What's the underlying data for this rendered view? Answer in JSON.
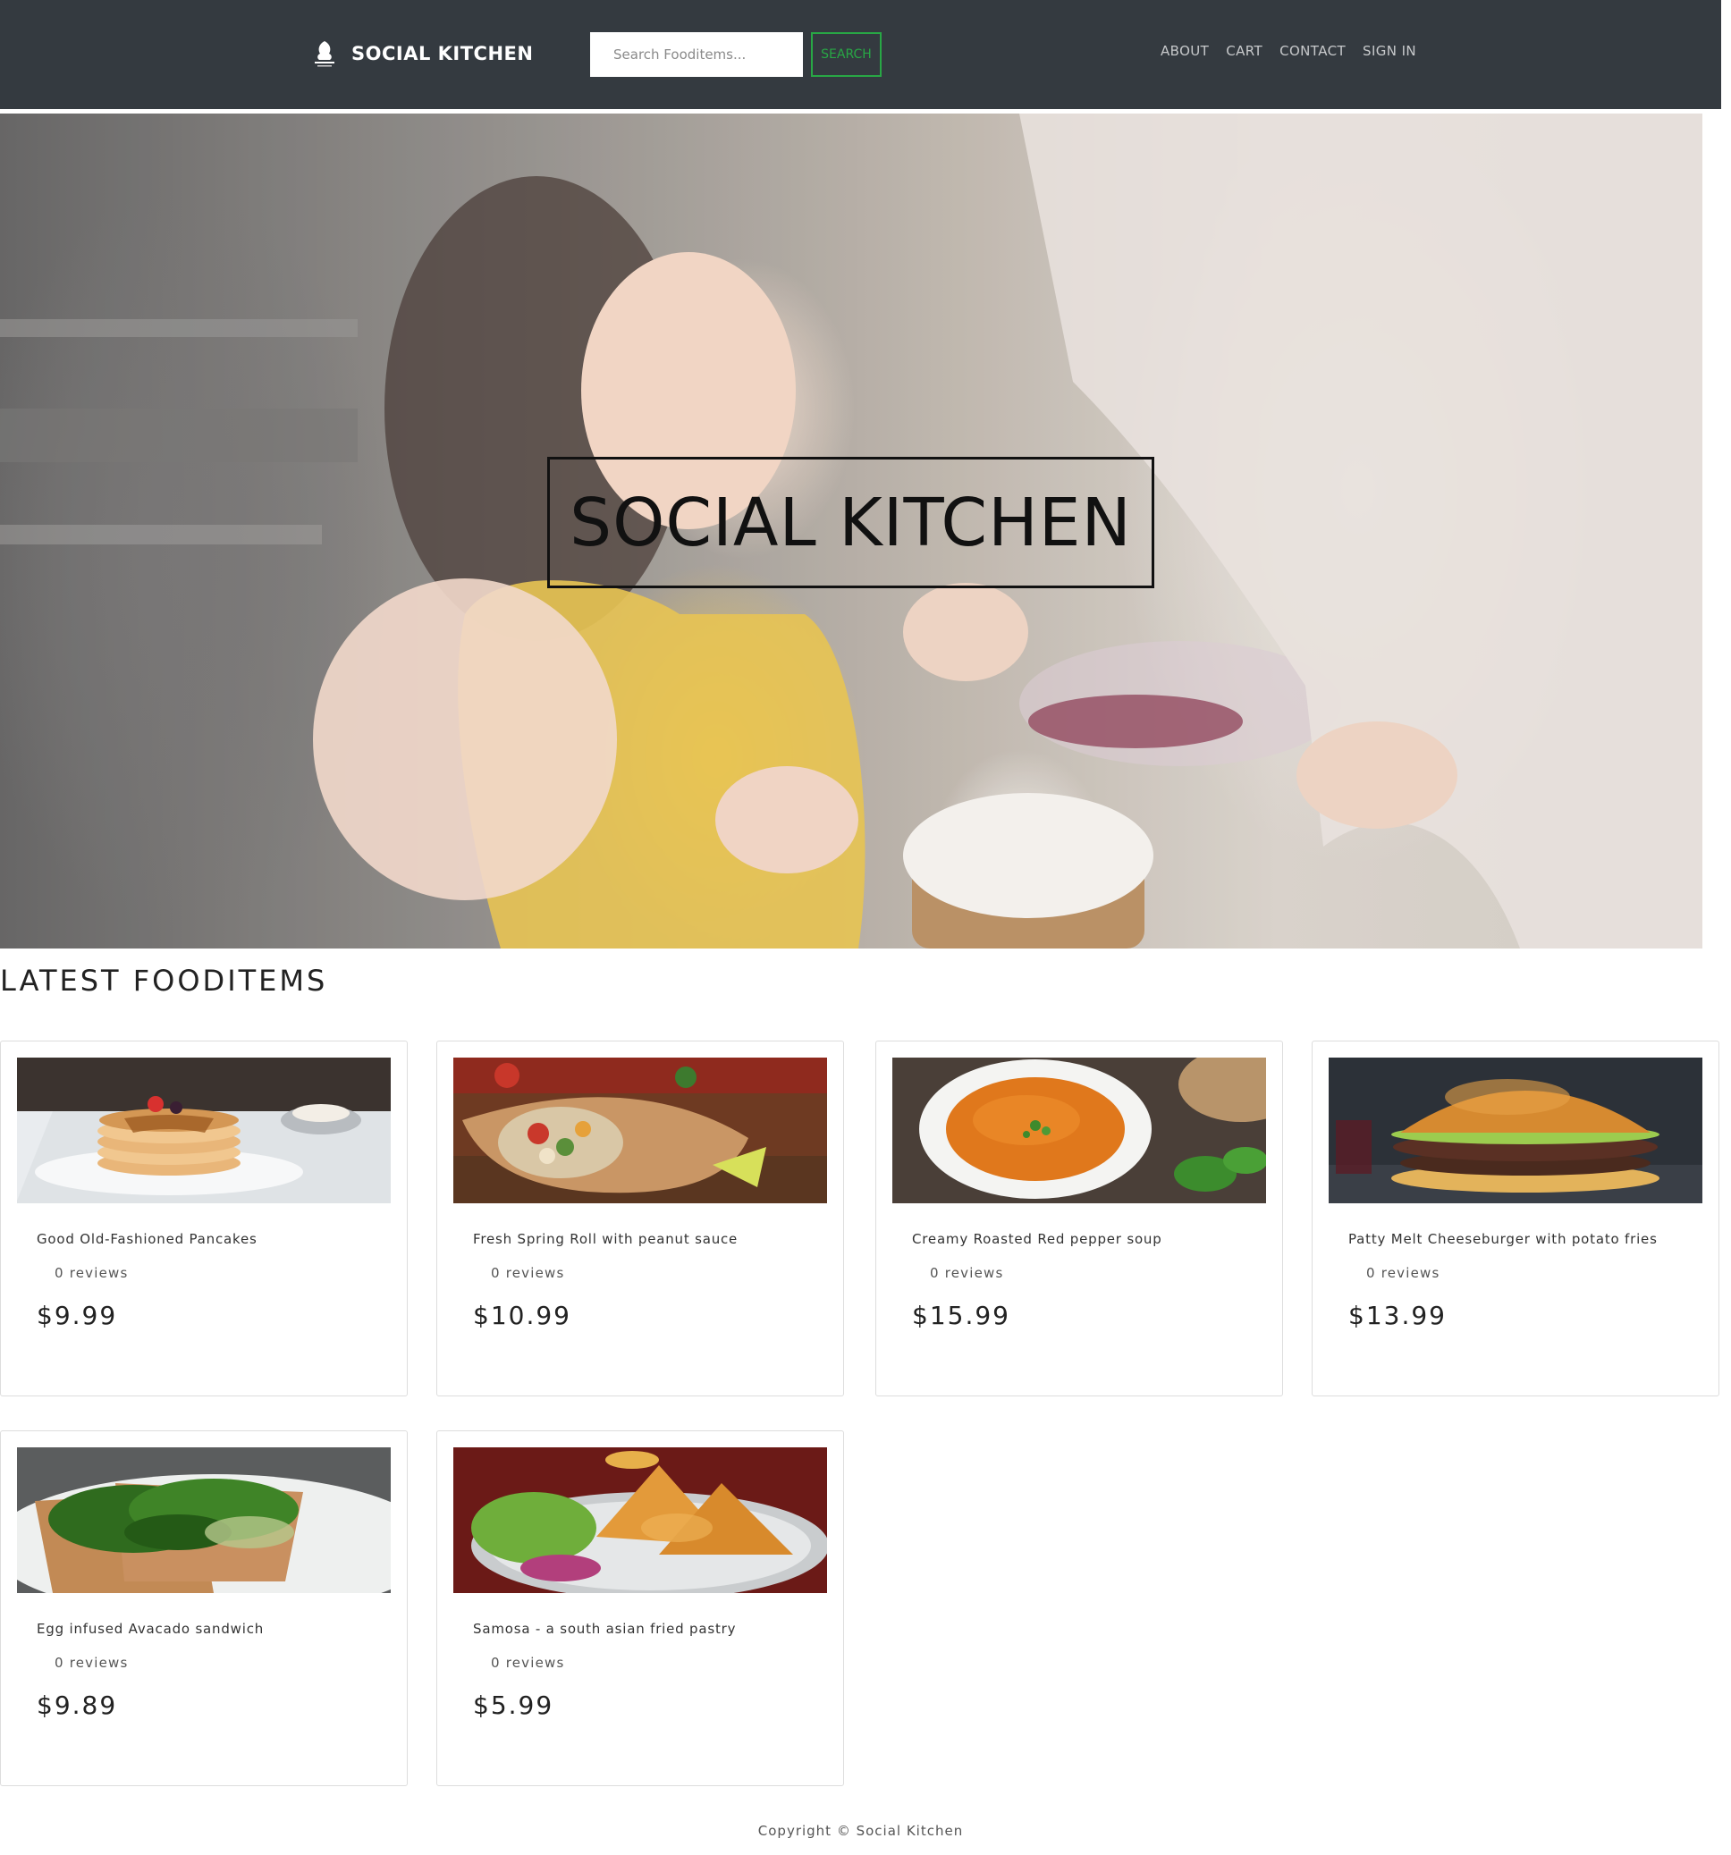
{
  "navbar": {
    "brand": "SOCIAL KITCHEN",
    "search_placeholder": "Search Fooditems...",
    "search_button": "SEARCH",
    "links": [
      "ABOUT",
      "CART",
      "CONTACT",
      "SIGN IN"
    ],
    "accent_color": "#28a745",
    "background_color": "#343a40"
  },
  "hero": {
    "title": "SOCIAL KITCHEN",
    "image_icon": "kitchen-photo"
  },
  "section": {
    "title": "LATEST FOODITEMS"
  },
  "items": [
    {
      "name": "Good Old-Fashioned Pancakes",
      "reviews": "0 reviews",
      "price": "$9.99",
      "image_icon": "pancakes-photo"
    },
    {
      "name": "Fresh Spring Roll with peanut sauce",
      "reviews": "0 reviews",
      "price": "$10.99",
      "image_icon": "spring-roll-photo"
    },
    {
      "name": "Creamy Roasted Red pepper soup",
      "reviews": "0 reviews",
      "price": "$15.99",
      "image_icon": "soup-photo"
    },
    {
      "name": "Patty Melt Cheeseburger with potato fries",
      "reviews": "0 reviews",
      "price": "$13.99",
      "image_icon": "burger-photo"
    },
    {
      "name": "Egg infused Avacado sandwich",
      "reviews": "0 reviews",
      "price": "$9.89",
      "image_icon": "avocado-toast-photo"
    },
    {
      "name": "Samosa - a south asian fried pastry",
      "reviews": "0 reviews",
      "price": "$5.99",
      "image_icon": "samosa-photo"
    }
  ],
  "footer": {
    "copyright": "Copyright © Social Kitchen"
  }
}
